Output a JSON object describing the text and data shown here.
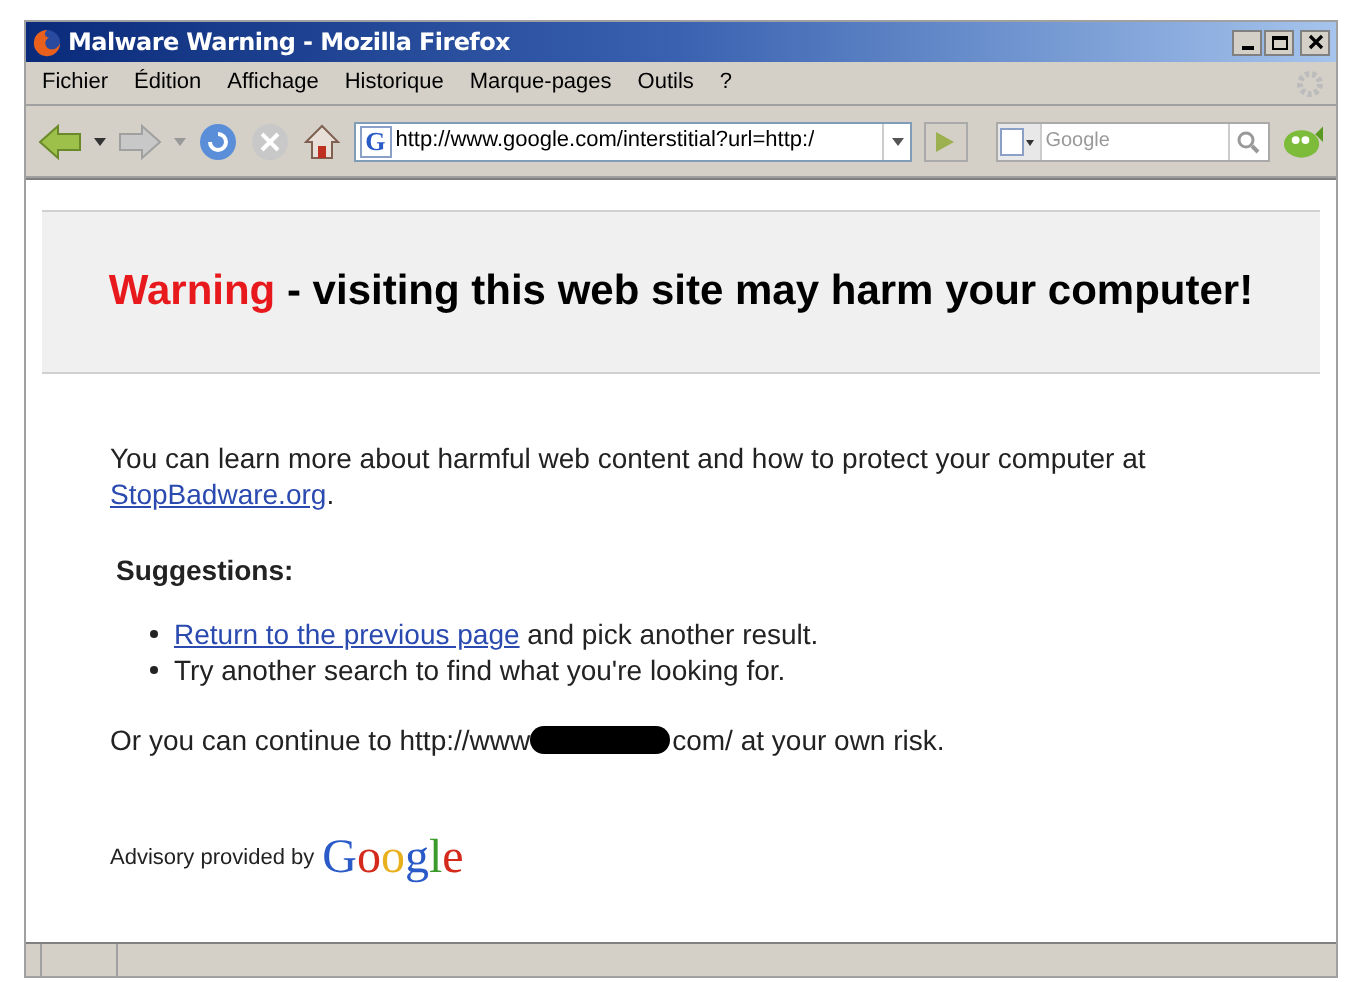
{
  "window": {
    "title": "Malware Warning - Mozilla Firefox"
  },
  "menu": [
    "Fichier",
    "Édition",
    "Affichage",
    "Historique",
    "Marque-pages",
    "Outils",
    "?"
  ],
  "address_bar": {
    "favicon": "G",
    "value": "http://www.google.com/interstitial?url=http:/"
  },
  "search": {
    "placeholder": "Google"
  },
  "page": {
    "warning_word": "Warning",
    "warning_rest": " - visiting this web site may harm your computer!",
    "intro": "You can learn more about harmful web content and how to protect your computer at",
    "intro_link": "StopBadware.org",
    "intro_end": ".",
    "suggestions_heading": "Suggestions:",
    "suggestions": [
      {
        "link": "Return to the previous page",
        "text": " and pick another result."
      },
      {
        "text": "Try another search to find what you're looking for."
      }
    ],
    "continue_before": "Or you can continue to http://www",
    "continue_after": "com/ at your own risk.",
    "advisory": "Advisory provided by",
    "logo": "Google"
  }
}
